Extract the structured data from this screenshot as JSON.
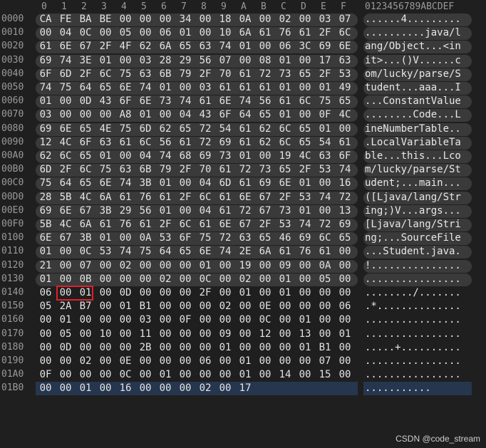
{
  "header": {
    "cols": [
      "0",
      "1",
      "2",
      "3",
      "4",
      "5",
      "6",
      "7",
      "8",
      "9",
      "A",
      "B",
      "C",
      "D",
      "E",
      "F"
    ],
    "ascii": "0123456789ABCDEF"
  },
  "rows": [
    {
      "offset": "0000",
      "hex": [
        "CA",
        "FE",
        "BA",
        "BE",
        "00",
        "00",
        "00",
        "34",
        "00",
        "18",
        "0A",
        "00",
        "02",
        "00",
        "03",
        "07"
      ],
      "ascii": "......4.........",
      "shaded": true
    },
    {
      "offset": "0010",
      "hex": [
        "00",
        "04",
        "0C",
        "00",
        "05",
        "00",
        "06",
        "01",
        "00",
        "10",
        "6A",
        "61",
        "76",
        "61",
        "2F",
        "6C"
      ],
      "ascii": "..........java/l",
      "shaded": true
    },
    {
      "offset": "0020",
      "hex": [
        "61",
        "6E",
        "67",
        "2F",
        "4F",
        "62",
        "6A",
        "65",
        "63",
        "74",
        "01",
        "00",
        "06",
        "3C",
        "69",
        "6E"
      ],
      "ascii": "ang/Object...<in",
      "shaded": true
    },
    {
      "offset": "0030",
      "hex": [
        "69",
        "74",
        "3E",
        "01",
        "00",
        "03",
        "28",
        "29",
        "56",
        "07",
        "00",
        "08",
        "01",
        "00",
        "17",
        "63"
      ],
      "ascii": "it>...()V......c",
      "shaded": true
    },
    {
      "offset": "0040",
      "hex": [
        "6F",
        "6D",
        "2F",
        "6C",
        "75",
        "63",
        "6B",
        "79",
        "2F",
        "70",
        "61",
        "72",
        "73",
        "65",
        "2F",
        "53"
      ],
      "ascii": "om/lucky/parse/S",
      "shaded": true
    },
    {
      "offset": "0050",
      "hex": [
        "74",
        "75",
        "64",
        "65",
        "6E",
        "74",
        "01",
        "00",
        "03",
        "61",
        "61",
        "61",
        "01",
        "00",
        "01",
        "49"
      ],
      "ascii": "tudent...aaa...I",
      "shaded": true
    },
    {
      "offset": "0060",
      "hex": [
        "01",
        "00",
        "0D",
        "43",
        "6F",
        "6E",
        "73",
        "74",
        "61",
        "6E",
        "74",
        "56",
        "61",
        "6C",
        "75",
        "65"
      ],
      "ascii": "...ConstantValue",
      "shaded": true
    },
    {
      "offset": "0070",
      "hex": [
        "03",
        "00",
        "00",
        "00",
        "A8",
        "01",
        "00",
        "04",
        "43",
        "6F",
        "64",
        "65",
        "01",
        "00",
        "0F",
        "4C"
      ],
      "ascii": "........Code...L",
      "shaded": true
    },
    {
      "offset": "0080",
      "hex": [
        "69",
        "6E",
        "65",
        "4E",
        "75",
        "6D",
        "62",
        "65",
        "72",
        "54",
        "61",
        "62",
        "6C",
        "65",
        "01",
        "00"
      ],
      "ascii": "ineNumberTable..",
      "shaded": true
    },
    {
      "offset": "0090",
      "hex": [
        "12",
        "4C",
        "6F",
        "63",
        "61",
        "6C",
        "56",
        "61",
        "72",
        "69",
        "61",
        "62",
        "6C",
        "65",
        "54",
        "61"
      ],
      "ascii": ".LocalVariableTa",
      "shaded": true
    },
    {
      "offset": "00A0",
      "hex": [
        "62",
        "6C",
        "65",
        "01",
        "00",
        "04",
        "74",
        "68",
        "69",
        "73",
        "01",
        "00",
        "19",
        "4C",
        "63",
        "6F"
      ],
      "ascii": "ble...this...Lco",
      "shaded": true
    },
    {
      "offset": "00B0",
      "hex": [
        "6D",
        "2F",
        "6C",
        "75",
        "63",
        "6B",
        "79",
        "2F",
        "70",
        "61",
        "72",
        "73",
        "65",
        "2F",
        "53",
        "74"
      ],
      "ascii": "m/lucky/parse/St",
      "shaded": true
    },
    {
      "offset": "00C0",
      "hex": [
        "75",
        "64",
        "65",
        "6E",
        "74",
        "3B",
        "01",
        "00",
        "04",
        "6D",
        "61",
        "69",
        "6E",
        "01",
        "00",
        "16"
      ],
      "ascii": "udent;...main...",
      "shaded": true
    },
    {
      "offset": "00D0",
      "hex": [
        "28",
        "5B",
        "4C",
        "6A",
        "61",
        "76",
        "61",
        "2F",
        "6C",
        "61",
        "6E",
        "67",
        "2F",
        "53",
        "74",
        "72"
      ],
      "ascii": "([Ljava/lang/Str",
      "shaded": true
    },
    {
      "offset": "00E0",
      "hex": [
        "69",
        "6E",
        "67",
        "3B",
        "29",
        "56",
        "01",
        "00",
        "04",
        "61",
        "72",
        "67",
        "73",
        "01",
        "00",
        "13"
      ],
      "ascii": "ing;)V...args...",
      "shaded": true
    },
    {
      "offset": "00F0",
      "hex": [
        "5B",
        "4C",
        "6A",
        "61",
        "76",
        "61",
        "2F",
        "6C",
        "61",
        "6E",
        "67",
        "2F",
        "53",
        "74",
        "72",
        "69"
      ],
      "ascii": "[Ljava/lang/Stri",
      "shaded": true
    },
    {
      "offset": "0100",
      "hex": [
        "6E",
        "67",
        "3B",
        "01",
        "00",
        "0A",
        "53",
        "6F",
        "75",
        "72",
        "63",
        "65",
        "46",
        "69",
        "6C",
        "65"
      ],
      "ascii": "ng;...SourceFile",
      "shaded": true
    },
    {
      "offset": "0110",
      "hex": [
        "01",
        "00",
        "0C",
        "53",
        "74",
        "75",
        "64",
        "65",
        "6E",
        "74",
        "2E",
        "6A",
        "61",
        "76",
        "61",
        "00"
      ],
      "ascii": "...Student.java.",
      "shaded": true
    },
    {
      "offset": "0120",
      "hex": [
        "21",
        "00",
        "07",
        "00",
        "02",
        "00",
        "00",
        "00",
        "01",
        "00",
        "19",
        "00",
        "09",
        "00",
        "0A",
        "00"
      ],
      "ascii": "!...............",
      "shaded": true
    },
    {
      "offset": "0130",
      "hex": [
        "01",
        "00",
        "0B",
        "00",
        "00",
        "00",
        "02",
        "00",
        "0C",
        "00",
        "02",
        "00",
        "01",
        "00",
        "05",
        "00"
      ],
      "ascii": "................",
      "shaded": true
    },
    {
      "offset": "0140",
      "hex": [
        "06",
        "00",
        "01",
        "00",
        "0D",
        "00",
        "00",
        "00",
        "2F",
        "00",
        "01",
        "00",
        "01",
        "00",
        "00",
        "00"
      ],
      "ascii": "......../.......",
      "shaded": false
    },
    {
      "offset": "0150",
      "hex": [
        "05",
        "2A",
        "B7",
        "00",
        "01",
        "B1",
        "00",
        "00",
        "00",
        "02",
        "00",
        "0E",
        "00",
        "00",
        "00",
        "06"
      ],
      "ascii": ".*..............",
      "shaded": false
    },
    {
      "offset": "0160",
      "hex": [
        "00",
        "01",
        "00",
        "00",
        "00",
        "03",
        "00",
        "0F",
        "00",
        "00",
        "00",
        "0C",
        "00",
        "01",
        "00",
        "00"
      ],
      "ascii": "................",
      "shaded": false
    },
    {
      "offset": "0170",
      "hex": [
        "00",
        "05",
        "00",
        "10",
        "00",
        "11",
        "00",
        "00",
        "00",
        "09",
        "00",
        "12",
        "00",
        "13",
        "00",
        "01"
      ],
      "ascii": "................",
      "shaded": false
    },
    {
      "offset": "0180",
      "hex": [
        "00",
        "0D",
        "00",
        "00",
        "00",
        "2B",
        "00",
        "00",
        "00",
        "01",
        "00",
        "00",
        "00",
        "01",
        "B1",
        "00"
      ],
      "ascii": ".....+..........",
      "shaded": false
    },
    {
      "offset": "0190",
      "hex": [
        "00",
        "00",
        "02",
        "00",
        "0E",
        "00",
        "00",
        "00",
        "06",
        "00",
        "01",
        "00",
        "00",
        "00",
        "07",
        "00"
      ],
      "ascii": "................",
      "shaded": false
    },
    {
      "offset": "01A0",
      "hex": [
        "0F",
        "00",
        "00",
        "00",
        "0C",
        "00",
        "01",
        "00",
        "00",
        "00",
        "01",
        "00",
        "14",
        "00",
        "15",
        "00"
      ],
      "ascii": "................",
      "shaded": false
    },
    {
      "offset": "01B0",
      "hex": [
        "00",
        "00",
        "01",
        "00",
        "16",
        "00",
        "00",
        "00",
        "02",
        "00",
        "17"
      ],
      "ascii": "...........",
      "shaded": false,
      "selected": true
    }
  ],
  "highlight": {
    "row": "0140",
    "bytes": [
      "00",
      "01"
    ],
    "color": "#e0202a"
  },
  "watermark": "CSDN @code_stream",
  "colors": {
    "background": "#1f1f1f",
    "shade": "#3a3a3a",
    "selection": "#26364e"
  }
}
